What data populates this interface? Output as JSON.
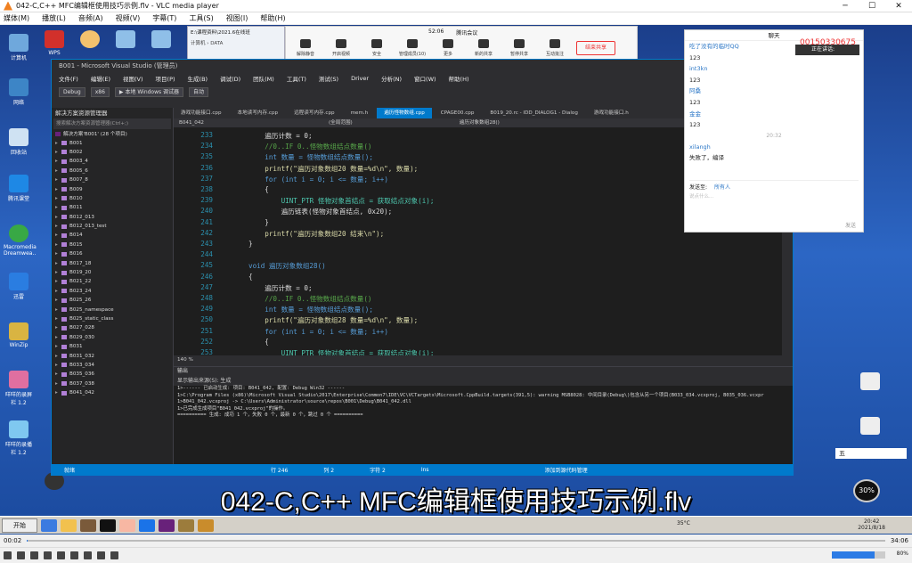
{
  "vlc": {
    "title": "042-C,C++ MFC编辑框使用技巧示例.flv - VLC media player",
    "menu": [
      "媒体(M)",
      "播放(L)",
      "音频(A)",
      "视频(V)",
      "字幕(T)",
      "工具(S)",
      "视图(I)",
      "帮助(H)"
    ],
    "time_current": "00:02",
    "time_total": "34:06",
    "volume": "80%",
    "progress_fraction": 0.001
  },
  "desktop": {
    "icons": [
      "计算机",
      "网络",
      "回收站",
      "腾讯课堂",
      "Macromedia Dreamwea..",
      "迅雷",
      "WinZip",
      "咩咩的录屏栏 1.2",
      "咩咩的录播栏 1.2",
      "WPS"
    ]
  },
  "explorer": {
    "path": "E:\\课程资料\\2021.6在线班",
    "crumb": "计算机 › DATA"
  },
  "meeting": {
    "timer": "52:06",
    "title": "腾讯会议",
    "buttons": [
      "解除静音",
      "开启视频",
      "安全",
      "管理成员(10)",
      "更多",
      "新的共享",
      "暂停共享",
      "互动批注"
    ],
    "end": "结束共享"
  },
  "vs": {
    "title": "B001 - Microsoft Visual Studio (管理员)",
    "menu": [
      "文件(F)",
      "编辑(E)",
      "视图(V)",
      "项目(P)",
      "生成(B)",
      "调试(D)",
      "团队(M)",
      "工具(T)",
      "测试(S)",
      "Driver",
      "分析(N)",
      "窗口(W)",
      "帮助(H)"
    ],
    "config": "Debug",
    "platform": "x86",
    "run": "▶ 本地 Windows 调试器",
    "auto": "自动",
    "solution_header": "解决方案资源管理器",
    "solution_search": "搜索解决方案资源管理器(Ctrl+;)",
    "solution_root": "解决方案'B001' (28 个项目)",
    "projects": [
      "B001",
      "B002",
      "B003_4",
      "B005_6",
      "B007_8",
      "B009",
      "B010",
      "B011",
      "B012_013",
      "B012_013_test",
      "B014",
      "B015",
      "B016",
      "B017_18",
      "B019_20",
      "B021_22",
      "B023_24",
      "B025_26",
      "B025_namespace",
      "B025_static_class",
      "B027_028",
      "B029_030",
      "B031",
      "B031_032",
      "B033_034",
      "B035_036",
      "B037_038",
      "B041_042"
    ],
    "tabs": [
      "游戏功能接口.cpp",
      "本地读写内存.cpp",
      "远程读写内存.cpp",
      "mem.h",
      "遍历怪物数组.cpp",
      "CPAGE00.cpp",
      "B019_20.rc - IDD_DIALOG1 - Dialog",
      "游戏功能接口.h"
    ],
    "nav": [
      "B041_042",
      "(全局范围)",
      "遍历对象数组28()"
    ],
    "zoom": "140 %",
    "output_header": "输出",
    "output_source": "显示输出来源(S): 生成",
    "output": [
      "1>------ 已启动生成: 项目: B041_042, 配置: Debug Win32 ------",
      "1>C:\\Program Files (x86)\\Microsoft Visual Studio\\2017\\Enterprise\\Common7\\IDE\\VC\\VCTargets\\Microsoft.CppBuild.targets(391,5): warning MSB8028: 中间目录(Debug\\)包含从另一个项目(B033_034.vcxproj, B035_036.vcxpr",
      "1>B041_042.vcxproj -> C:\\Users\\Administrator\\source\\repos\\B001\\Debug\\B041_042.dll",
      "1>已完成生成项目\"B041_042.vcxproj\"的操作。",
      "========== 生成: 成功 1 个，失败 0 个，最新 0 个，跳过 0 个 =========="
    ],
    "status": [
      "就绪",
      "行 246",
      "列 2",
      "字符 2",
      "Ins",
      "添加到源代码管理"
    ]
  },
  "code": [
    {
      "n": "233",
      "t": "    遍历计数 = 0;"
    },
    {
      "n": "234",
      "t": "    //0..IF 0..怪物数组结点数量()"
    },
    {
      "n": "235",
      "t": "    int 数量 = 怪物数组结点数量();"
    },
    {
      "n": "236",
      "t": "    printf(\"遍历对象数组20 数量=%d\\n\", 数量);"
    },
    {
      "n": "237",
      "t": "    for (int i = 0; i <= 数量; i++)"
    },
    {
      "n": "238",
      "t": "    {"
    },
    {
      "n": "239",
      "t": "        UINT_PTR 怪物对象首结点 = 获取结点对象(i);"
    },
    {
      "n": "240",
      "t": "        遍历链表(怪物对象首结点, 0x20);"
    },
    {
      "n": "241",
      "t": "    }"
    },
    {
      "n": "242",
      "t": "    printf(\"遍历对象数组20 结束\\n\");"
    },
    {
      "n": "243",
      "t": "}"
    },
    {
      "n": "244",
      "t": ""
    },
    {
      "n": "245",
      "t": "void 遍历对象数组28()"
    },
    {
      "n": "246",
      "t": "{"
    },
    {
      "n": "247",
      "t": "    遍历计数 = 0;"
    },
    {
      "n": "248",
      "t": "    //0..IF 0..怪物数组结点数量()"
    },
    {
      "n": "249",
      "t": "    int 数量 = 怪物数组结点数量();"
    },
    {
      "n": "250",
      "t": "    printf(\"遍历对象数组28 数量=%d\\n\", 数量);"
    },
    {
      "n": "251",
      "t": "    for (int i = 0; i <= 数量; i++)"
    },
    {
      "n": "252",
      "t": "    {"
    },
    {
      "n": "253",
      "t": "        UINT_PTR 怪物对象首结点 = 获取结点对象(i);"
    }
  ],
  "chat": {
    "header": "聊天",
    "speaking": "正在讲话:",
    "badge": "00150330675",
    "messages": [
      {
        "who": "吃了没有的临时QQ",
        "text": "123"
      },
      {
        "who": "int3kn",
        "text": "123"
      },
      {
        "who": "阿桑",
        "text": "123"
      },
      {
        "who": "金金",
        "text": "123"
      }
    ],
    "time": "20:32",
    "who2": "xilangh",
    "text2": "失败了，编译",
    "send_to": "发送至:",
    "target": "所有人",
    "input_ph": "说点什么...",
    "send": "发送"
  },
  "subtitle": "042-C,C++ MFC编辑框使用技巧示例.flv",
  "taskbar": {
    "start": "开始",
    "temp": "35°C",
    "clock": "20:42",
    "date": "2021/8/18",
    "cpu": "30%",
    "ime": "五"
  }
}
